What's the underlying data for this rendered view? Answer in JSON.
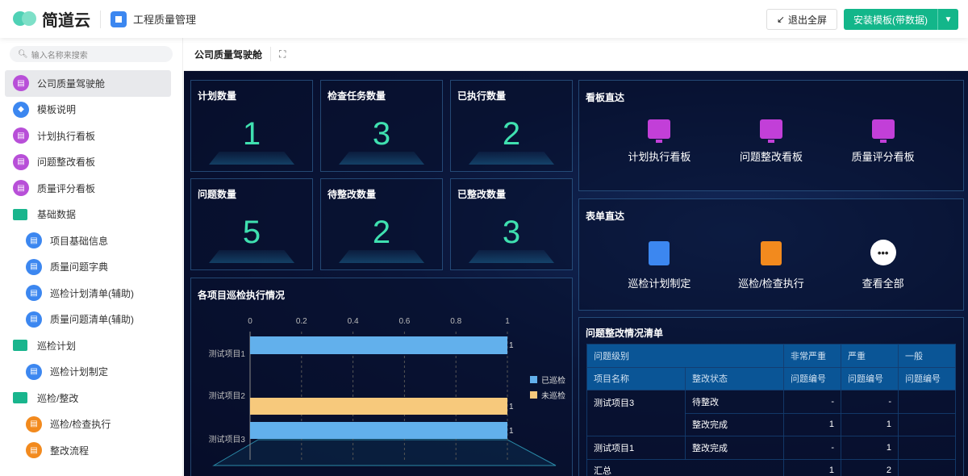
{
  "header": {
    "brand": "简道云",
    "app_name": "工程质量管理",
    "exit_fullscreen": "退出全屏",
    "install": "安装模板(带数据)"
  },
  "sidebar": {
    "search_placeholder": "输入名称来搜索",
    "items": [
      {
        "label": "公司质量驾驶舱",
        "icon": "dashboard-icon",
        "active": true
      },
      {
        "label": "模板说明",
        "icon": "tag-icon"
      },
      {
        "label": "计划执行看板",
        "icon": "dashboard-icon"
      },
      {
        "label": "问题整改看板",
        "icon": "dashboard-icon"
      },
      {
        "label": "质量评分看板",
        "icon": "dashboard-icon"
      },
      {
        "label": "基础数据",
        "icon": "folder-icon"
      },
      {
        "label": "项目基础信息",
        "icon": "form-icon"
      },
      {
        "label": "质量问题字典",
        "icon": "form-icon"
      },
      {
        "label": "巡检计划清单(辅助)",
        "icon": "form-icon"
      },
      {
        "label": "质量问题清单(辅助)",
        "icon": "form-icon"
      },
      {
        "label": "巡检计划",
        "icon": "folder-icon"
      },
      {
        "label": "巡检计划制定",
        "icon": "form-icon"
      },
      {
        "label": "巡检/整改",
        "icon": "folder-icon"
      },
      {
        "label": "巡检/检查执行",
        "icon": "flow-icon"
      },
      {
        "label": "整改流程",
        "icon": "flow-icon"
      }
    ]
  },
  "content": {
    "title": "公司质量驾驶舱"
  },
  "kpis": [
    {
      "label": "计划数量",
      "value": "1"
    },
    {
      "label": "检查任务数量",
      "value": "3"
    },
    {
      "label": "已执行数量",
      "value": "2"
    },
    {
      "label": "问题数量",
      "value": "5"
    },
    {
      "label": "待整改数量",
      "value": "2"
    },
    {
      "label": "已整改数量",
      "value": "3"
    }
  ],
  "board_links": {
    "title": "看板直达",
    "items": [
      "计划执行看板",
      "问题整改看板",
      "质量评分看板"
    ]
  },
  "form_links": {
    "title": "表单直达",
    "items": [
      "巡检计划制定",
      "巡检/检查执行",
      "查看全部"
    ]
  },
  "chart_data": {
    "type": "bar",
    "title": "各项目巡检执行情况",
    "categories": [
      "测试项目1",
      "测试项目2",
      "测试项目3"
    ],
    "xlim": [
      0,
      1
    ],
    "ticks": [
      "0",
      "0.2",
      "0.4",
      "0.6",
      "0.8",
      "1"
    ],
    "series": [
      {
        "name": "已巡检",
        "color": "#62b0ec",
        "values": [
          1,
          0,
          1
        ]
      },
      {
        "name": "未巡检",
        "color": "#f7c97c",
        "values": [
          0,
          1,
          0
        ]
      }
    ],
    "legend": "right"
  },
  "issue_table": {
    "title": "问题整改情况清单",
    "h1": [
      "问题级别",
      "非常严重",
      "严重",
      "一般"
    ],
    "h2": [
      "项目名称",
      "整改状态",
      "问题编号",
      "问题编号",
      "问题编号"
    ],
    "rows": [
      [
        "测试项目3",
        "待整改",
        "-",
        "-",
        ""
      ],
      [
        "",
        "整改完成",
        "1",
        "1",
        ""
      ],
      [
        "测试项目1",
        "整改完成",
        "-",
        "1",
        ""
      ]
    ],
    "total": [
      "汇总",
      "1",
      "2",
      ""
    ]
  }
}
